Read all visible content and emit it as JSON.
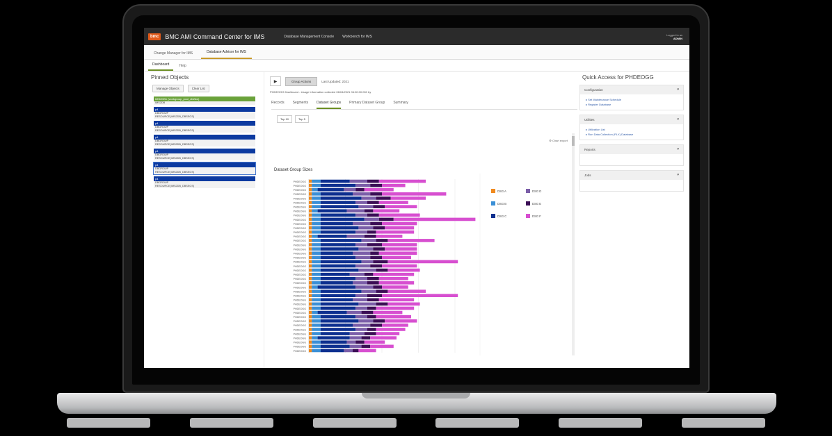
{
  "app": {
    "logo": "bmc",
    "title": "BMC AMI Command Center for IMS",
    "top_links": [
      "Database Management Console",
      "Workbench for IMS"
    ],
    "user_line": "Logged in as",
    "user_name": "ADMIN"
  },
  "main_tabs": [
    {
      "label": "Change Manager for IMS",
      "active": false
    },
    {
      "label": "Database Advisor for IMS",
      "active": true
    }
  ],
  "sub_tabs": [
    {
      "label": "Dashboard",
      "active": true
    },
    {
      "label": "Help",
      "active": false
    }
  ],
  "left_panel": {
    "title": "Pinned Objects",
    "btn_manage": "Manage Objects",
    "btn_clear": "Clear List",
    "objects": [
      {
        "head": "IMS2DB1 (workgroup_pool_db2dw)",
        "lines": [
          "IMS2DB"
        ],
        "green": true,
        "selected": false
      },
      {
        "head": "p4",
        "lines": [
          "DBGROUP",
          "RESOURCE(IMS2DB_DBSEGS)"
        ],
        "green": false,
        "selected": false
      },
      {
        "head": "p4",
        "lines": [
          "DBGROUP",
          "RESOURCE(IMS2DB_DBSEGS)"
        ],
        "green": false,
        "selected": false
      },
      {
        "head": "p4",
        "lines": [
          "DBGROUP",
          "RESOURCE(IMS2DB_DBSEGS)"
        ],
        "green": false,
        "selected": false
      },
      {
        "head": "p4",
        "lines": [
          "DBGROUP",
          "RESOURCE(IMS2DB_DBSEGS)"
        ],
        "green": false,
        "selected": false
      },
      {
        "head": "p4",
        "lines": [
          "DBGROUP",
          "RESOURCE(IMS2DB_DBSEGS)"
        ],
        "green": false,
        "selected": true
      },
      {
        "head": "p4",
        "lines": [
          "DBGROUP",
          "RESOURCE(IMS2DB_DBSEGS)"
        ],
        "green": false,
        "selected": false
      }
    ]
  },
  "center": {
    "group_btn": "Group Actions",
    "toolbar_label": "Last Updated: 2021",
    "crumb": "PHDEOGG Dashboard - Usage Information collected 06/04/2021 06:00:00.000 by",
    "tabs": [
      {
        "label": "Records",
        "active": false
      },
      {
        "label": "Segments",
        "active": false
      },
      {
        "label": "Dataset Groups",
        "active": true
      },
      {
        "label": "Primary Dataset Group",
        "active": false
      },
      {
        "label": "Summary",
        "active": false
      }
    ],
    "top_buttons": [
      "Top 10",
      "Top 5"
    ],
    "export_label": "Chart export"
  },
  "chart_data": {
    "type": "bar",
    "orientation": "horizontal",
    "stacked": true,
    "title": "Dataset Group Sizes",
    "categories": [
      "PHDEOGG",
      "PHDEOGG",
      "PHDEOGG",
      "PHDEOGG",
      "PHDEOGG",
      "PHDEOGG",
      "PHDEOGG",
      "PHDEOGG",
      "PHDEOGG",
      "PHDEOGG",
      "PHDEOGG",
      "PHDEOGG",
      "PHDEOGG",
      "PHDEOGG",
      "PHDEOGG",
      "PHDEOGG",
      "PHDEOGG",
      "PHDEOGG",
      "PHDEOGG",
      "PHDEOGG",
      "PHDEOGG",
      "PHDEOGG",
      "PHDEOGG",
      "PHDEOGG",
      "PHDEOGG",
      "PHDEOGG",
      "PHDEOGG",
      "PHDEOGG",
      "PHDEOGG",
      "PHDEOGG",
      "PHDEOGG",
      "PHDEOGG",
      "PHDEOGG",
      "PHDEOGG",
      "PHDEOGG",
      "PHDEOGG",
      "PHDEOGG",
      "PHDEOGG",
      "PHDEOGG",
      "PHDEOGG",
      "PHDEOGG"
    ],
    "series": [
      {
        "name": "DSG A",
        "color": "#f08a1e",
        "values": [
          1,
          1,
          1,
          1,
          1,
          1,
          1,
          1,
          1,
          1,
          1,
          1,
          1,
          1,
          1,
          1,
          1,
          1,
          1,
          1,
          1,
          1,
          1,
          1,
          1,
          1,
          1,
          1,
          1,
          1,
          1,
          1,
          1,
          1,
          1,
          1,
          1,
          1,
          1,
          1,
          1
        ]
      },
      {
        "name": "DSG B",
        "color": "#3a8fd6",
        "values": [
          3,
          3,
          2,
          3,
          3,
          3,
          3,
          2,
          3,
          3,
          3,
          3,
          3,
          2,
          3,
          3,
          3,
          3,
          3,
          3,
          3,
          3,
          3,
          3,
          3,
          2,
          3,
          3,
          3,
          3,
          3,
          2,
          3,
          3,
          3,
          3,
          3,
          2,
          3,
          3,
          3
        ]
      },
      {
        "name": "DSG C",
        "color": "#0d2f8f",
        "values": [
          10,
          12,
          9,
          11,
          14,
          12,
          13,
          10,
          12,
          15,
          11,
          13,
          12,
          10,
          14,
          12,
          13,
          11,
          12,
          14,
          12,
          13,
          10,
          12,
          11,
          13,
          14,
          12,
          11,
          13,
          12,
          10,
          12,
          13,
          11,
          12,
          10,
          11,
          9,
          10,
          8
        ]
      },
      {
        "name": "DSG D",
        "color": "#7b5ea8",
        "values": [
          6,
          5,
          4,
          6,
          5,
          4,
          5,
          6,
          4,
          5,
          6,
          5,
          4,
          6,
          5,
          4,
          5,
          6,
          5,
          4,
          5,
          6,
          5,
          4,
          5,
          6,
          5,
          4,
          5,
          6,
          4,
          5,
          4,
          5,
          6,
          4,
          5,
          4,
          3,
          4,
          3
        ]
      },
      {
        "name": "DSG E",
        "color": "#3b0d55",
        "values": [
          4,
          4,
          3,
          4,
          5,
          4,
          4,
          3,
          4,
          5,
          4,
          4,
          3,
          4,
          4,
          5,
          4,
          3,
          4,
          5,
          4,
          4,
          3,
          4,
          4,
          3,
          4,
          5,
          4,
          4,
          3,
          4,
          3,
          4,
          4,
          3,
          4,
          3,
          3,
          3,
          2
        ]
      },
      {
        "name": "DSG F",
        "color": "#d74fd0",
        "values": [
          16,
          8,
          10,
          22,
          12,
          10,
          11,
          9,
          14,
          28,
          12,
          10,
          13,
          9,
          16,
          12,
          11,
          13,
          10,
          24,
          12,
          11,
          14,
          10,
          12,
          9,
          13,
          26,
          12,
          11,
          13,
          10,
          12,
          11,
          9,
          10,
          8,
          9,
          7,
          8,
          6
        ]
      }
    ],
    "legend": {
      "position": "right"
    },
    "grid": true
  },
  "right_panel": {
    "title": "Quick Access for PHDEOGG",
    "sections": [
      {
        "header": "Configuration",
        "links": [
          "Set Maintenance Schedule",
          "Register Database"
        ]
      },
      {
        "header": "Utilities",
        "links": [
          "Utilization List",
          "Run Data Collection (PLX) Database"
        ]
      },
      {
        "header": "Reports",
        "links": []
      },
      {
        "header": "Jobs",
        "links": []
      }
    ]
  }
}
